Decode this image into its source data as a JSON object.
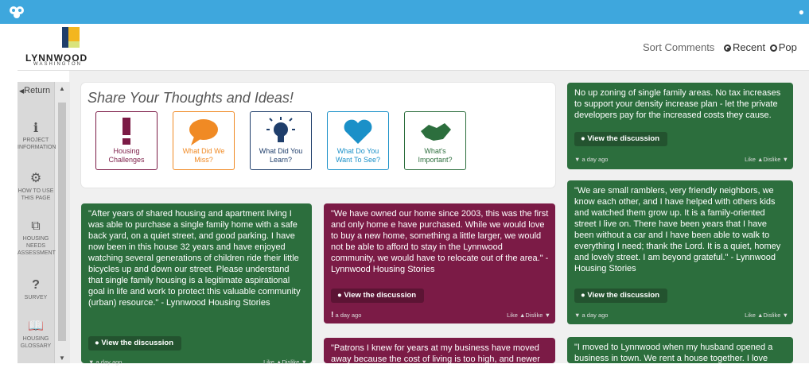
{
  "header": {
    "brand_name": "LYNNWOOD",
    "brand_sub": "WASHINGTON",
    "sort_label": "Sort Comments",
    "sort_options": [
      "Recent",
      "Pop"
    ],
    "accent_color": "#3ea7dd"
  },
  "sidebar": {
    "return_label": "Return",
    "items": [
      {
        "icon": "info-icon",
        "label_1": "PROJECT",
        "label_2": "INFORMATION"
      },
      {
        "icon": "gear-icon",
        "label_1": "HOW TO USE",
        "label_2": "THIS PAGE"
      },
      {
        "icon": "copy-icon",
        "label_1": "HOUSING",
        "label_2": "NEEDS",
        "label_3": "ASSESSMENT"
      },
      {
        "icon": "question-icon",
        "label_1": "SURVEY"
      },
      {
        "icon": "book-icon",
        "label_1": "HOUSING",
        "label_2": "GLOSSARY"
      }
    ]
  },
  "share": {
    "title": "Share Your Thoughts and Ideas!",
    "categories": [
      {
        "line1": "Housing",
        "line2": "Challenges",
        "color": "#7b1b46",
        "icon": "exclamation-icon"
      },
      {
        "line1": "What Did We",
        "line2": "Miss?",
        "color": "#f08a24",
        "icon": "speech-bubble-icon"
      },
      {
        "line1": "What Did You",
        "line2": "Learn?",
        "color": "#1f3e6b",
        "icon": "lightbulb-icon"
      },
      {
        "line1": "What Do You",
        "line2": "Want To See?",
        "color": "#1a90c8",
        "icon": "heart-icon"
      },
      {
        "line1": "What's",
        "line2": "Important?",
        "color": "#2c6e3d",
        "icon": "handshake-icon"
      }
    ]
  },
  "posts": {
    "discussion_label": "View the discussion",
    "time_label": "a day ago",
    "like_label": "Like",
    "dislike_label": "Dislike",
    "p1": "\"After years of shared housing and apartment living I was able to purchase a single family home with a safe back yard, on a quiet street, and good parking. I have now been in this house 32 years and have enjoyed watching several generations of children ride their little bicycles up and down our street. Please understand that single family housing is a legitimate aspirational goal in life and work to protect this valuable community (urban) resource.\" - Lynnwood Housing Stories",
    "p2": "\"We have owned our home since 2003, this was the first and only home e have purchased. While we would love to buy a new home, something a little larger, we would not be able to afford to stay in the Lynnwood community, we would have to relocate out of the area.\" - Lynnwood Housing Stories",
    "p3": "\"Patrons I knew for years at my business have moved away because the cost of living is too high, and newer",
    "p4": "No up zoning of single family areas. No tax increases to support your density increase plan - let the private developers pay for the increased costs they cause.",
    "p5": "\"We are small ramblers, very friendly neighbors, we know each other, and I have helped with others kids and watched them grow up. It is a family-oriented street I live on. There have been years that I have been without a car and I have been able to walk to everything I need; thank the Lord. It is a quiet, homey and lovely street. I am beyond grateful.\" - Lynnwood Housing Stories",
    "p6": "\"I moved to Lynnwood when my husband opened a business in town. We rent a house together. I love"
  }
}
